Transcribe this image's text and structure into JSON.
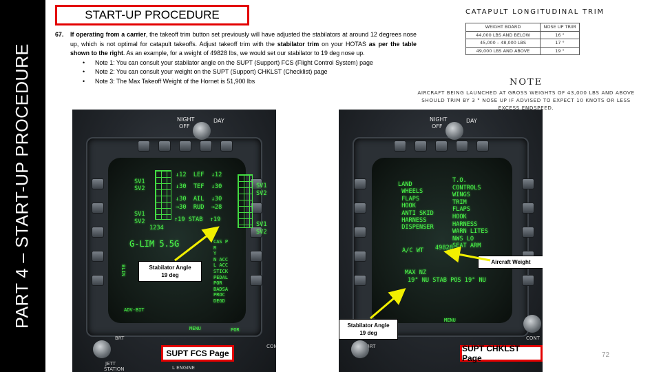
{
  "sidebar": {
    "title": "PART 4 – START-UP PROCEDURE"
  },
  "section": {
    "title": "START-UP PROCEDURE"
  },
  "step": {
    "number": "67.",
    "lead_bold": "If operating from a carrier",
    "text_1": ", the takeoff trim button set previously will have adjusted the stabilators at around 12 degrees nose up, which is not optimal for catapult takeoffs. Adjust takeoff trim with the ",
    "bold_2": "stabilator trim",
    "text_2": " on your HOTAS ",
    "bold_3": "as per the table shown to the right",
    "text_3": ". As an example, for a weight of 49828 lbs, we would set our stabilator to 19 deg nose up.",
    "notes": [
      "Note 1: You can consult your stabilator angle on the SUPT (Support) FCS (Flight Control System) page",
      "Note 2: You can consult your weight on the SUPT (Support) CHKLST (Checklist) page",
      "Note 3: The Max Takeoff Weight of the Hornet is 51,900 lbs"
    ]
  },
  "trim_table": {
    "title": "CATAPULT LONGITUDINAL TRIM",
    "headers": [
      "WEIGHT BOARD",
      "NOSE UP TRIM"
    ],
    "rows": [
      [
        "44,000 LBS AND BELOW",
        "16 °"
      ],
      [
        "45,000 – 48,000 LBS",
        "17 °"
      ],
      [
        "49,000 LBS AND ABOVE",
        "19 °"
      ]
    ]
  },
  "note": {
    "title": "NOTE",
    "body": "AIRCRAFT BEING LAUNCHED AT GROSS WEIGHTS OF 43,000 LBS AND ABOVE SHOULD TRIM BY 3 ° NOSE UP IF ADVISED TO EXPECT 10 KNOTS OR LESS EXCESS ENDSPEED."
  },
  "mfd_common": {
    "knob_night": "NIGHT",
    "knob_off": "OFF",
    "knob_day": "DAY",
    "brt": "BRT",
    "cont": "CONT"
  },
  "fcs_page": {
    "label": "SUPT FCS Page",
    "callout_title": "Stabilator Angle",
    "callout_value": "19 deg",
    "rows": [
      "↓12  LEF  ↓12",
      "↓30  TEF  ↓30",
      "↓30  AIL  ↓30",
      "→30  RUD  →28",
      "↑19 STAB  ↑19"
    ],
    "sv_left": [
      "SV1",
      "SV2",
      "SV1",
      "SV2"
    ],
    "sv_right": [
      "SV1",
      "SV2",
      "SV1",
      "SV2"
    ],
    "channels": "1234",
    "glim": "G-LIM 5.5G",
    "side_list": [
      "CAS P",
      "R",
      "Y",
      "N ACC",
      "L ACC",
      "STICK",
      "PEDAL",
      "POR",
      "BADSA",
      "PROC",
      "DEGD"
    ],
    "bottom_left": "ADV-BIT",
    "menu": "MENU",
    "por": "POR",
    "blin": "BLIN",
    "jett": "JETT",
    "station": "STATION",
    "l_engine": "L ENGINE"
  },
  "chklst_page": {
    "label": "SUPT CHKLST Page",
    "callout_weight": "Aircraft Weight",
    "callout_title": "Stabilator Angle",
    "callout_value": "19 deg",
    "land_header": "LAND",
    "land_items": [
      "WHEELS",
      "FLAPS",
      "HOOK",
      "ANTI SKID",
      "HARNESS",
      "DISPENSER"
    ],
    "to_header": "T.O.",
    "to_items": [
      "CONTROLS",
      "WINGS",
      "TRIM",
      "FLAPS",
      "HOOK",
      "HARNESS",
      "WARN LITES",
      "NWS LO",
      "SEAT ARM"
    ],
    "ac_wt_label": "A/C WT",
    "ac_wt_value": "49828",
    "max_nz": "MAX NZ",
    "stab_pos": "19° NU STAB POS 19° NU",
    "menu": "MENU"
  },
  "page_number": "72",
  "colors": {
    "red": "#e30000",
    "mfd_green": "#4cff4a",
    "sidebar": "#000000"
  }
}
